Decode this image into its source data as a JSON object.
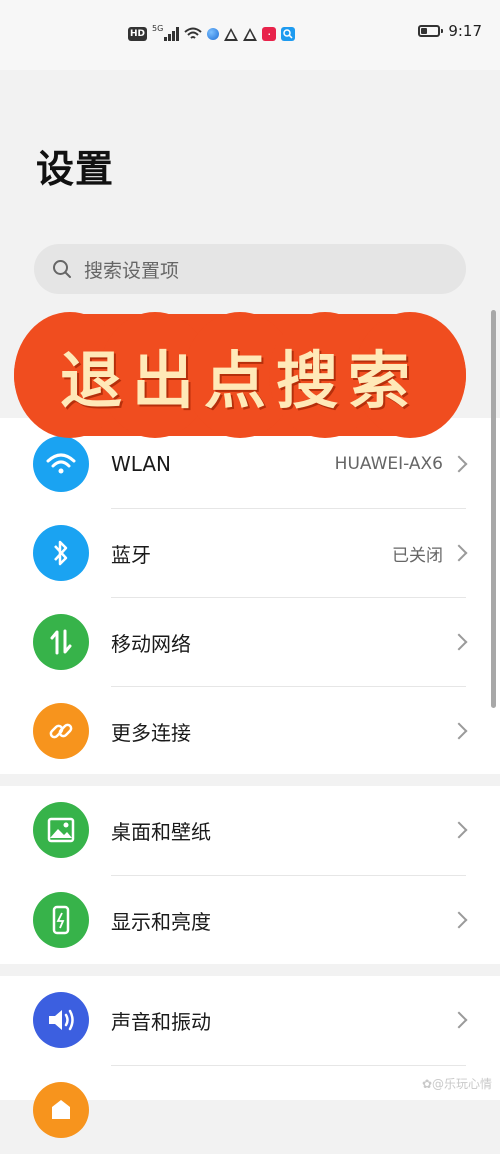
{
  "status_bar": {
    "network_type": "5G",
    "hd_badge": "HD",
    "time": "9:17",
    "battery_level_percent": 35,
    "icons": [
      "hd-icon",
      "signal-icon",
      "wifi-icon",
      "browser-icon",
      "warning-icon",
      "warning-icon",
      "app-icon",
      "search-app-icon"
    ]
  },
  "header": {
    "title": "设置"
  },
  "search": {
    "placeholder": "搜索设置项"
  },
  "banner": {
    "text": "退出点搜索",
    "color": "#f04d1f",
    "text_color": "#ffe9b8"
  },
  "sections": [
    {
      "items": [
        {
          "label": "WLAN",
          "value": "HUAWEI-AX6",
          "icon": "wifi-icon",
          "color": "#1aa3f2"
        },
        {
          "label": "蓝牙",
          "value": "已关闭",
          "icon": "bluetooth-icon",
          "color": "#1aa3f2"
        },
        {
          "label": "移动网络",
          "value": "",
          "icon": "mobile-data-icon",
          "color": "#37b34a"
        },
        {
          "label": "更多连接",
          "value": "",
          "icon": "link-icon",
          "color": "#f7941d"
        }
      ]
    },
    {
      "items": [
        {
          "label": "桌面和壁纸",
          "value": "",
          "icon": "image-icon",
          "color": "#37b34a"
        },
        {
          "label": "显示和亮度",
          "value": "",
          "icon": "phone-brightness-icon",
          "color": "#37b34a"
        }
      ]
    },
    {
      "items": [
        {
          "label": "声音和振动",
          "value": "",
          "icon": "speaker-icon",
          "color": "#3c5fe0"
        },
        {
          "label": "",
          "value": "",
          "icon": "notification-icon",
          "color": "#f7941d"
        }
      ]
    }
  ],
  "watermark": "✿@乐玩心情"
}
